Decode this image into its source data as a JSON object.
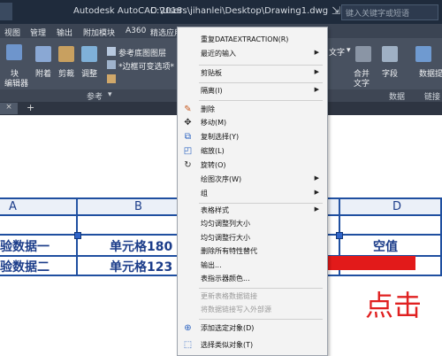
{
  "titlebar": {
    "app_name": "Autodesk AutoCAD 2018",
    "file_path": "C:\\Users\\jihanlei\\Desktop\\Drawing1.dwg",
    "search_placeholder": "键入关键字或短语"
  },
  "menubar": {
    "items": [
      "视图",
      "管理",
      "输出",
      "附加模块",
      "A360",
      "精选应用"
    ]
  },
  "ribbon": {
    "left_buttons": [
      "块",
      "编辑器",
      "附着",
      "剪裁",
      "调整"
    ],
    "reference_items": [
      "参考底图图层",
      "*边框可变选项*"
    ],
    "panel_reference": "参考",
    "right_buttons": [
      "文字",
      "合并",
      "文字",
      "字段"
    ],
    "panel_data": "数据",
    "data_extract": "数据提",
    "link_panel": "链接"
  },
  "table": {
    "col_headers": [
      "A",
      "B",
      "D"
    ],
    "rows": [
      {
        "c1": "验数据一",
        "c2": "单元格180",
        "c4": "空值"
      },
      {
        "c1": "验数据二",
        "c2": "单元格123",
        "c4": ""
      }
    ]
  },
  "context_menu": {
    "items": [
      {
        "label": "重复DATAEXTRACTION(R)",
        "submenu": false,
        "disabled": false
      },
      {
        "label": "最近的输入",
        "submenu": true,
        "disabled": false
      },
      {
        "label": "剪贴板",
        "submenu": true,
        "disabled": false
      },
      {
        "label": "隔离(I)",
        "submenu": true,
        "disabled": false
      },
      {
        "label": "删除",
        "submenu": false,
        "disabled": false,
        "icon": "eraser-icon"
      },
      {
        "label": "移动(M)",
        "submenu": false,
        "disabled": false,
        "icon": "move-icon"
      },
      {
        "label": "复制选择(Y)",
        "submenu": false,
        "disabled": false,
        "icon": "copy-icon"
      },
      {
        "label": "缩放(L)",
        "submenu": false,
        "disabled": false,
        "icon": "scale-icon"
      },
      {
        "label": "旋转(O)",
        "submenu": false,
        "disabled": false,
        "icon": "rotate-icon"
      },
      {
        "label": "绘图次序(W)",
        "submenu": true,
        "disabled": false
      },
      {
        "label": "组",
        "submenu": true,
        "disabled": false
      },
      {
        "label": "表格样式",
        "submenu": true,
        "disabled": false
      },
      {
        "label": "均匀调整列大小",
        "submenu": false,
        "disabled": false
      },
      {
        "label": "均匀调整行大小",
        "submenu": false,
        "disabled": false
      },
      {
        "label": "删除所有特性替代",
        "submenu": false,
        "disabled": false
      },
      {
        "label": "输出...",
        "submenu": false,
        "disabled": false
      },
      {
        "label": "表指示器颜色...",
        "submenu": false,
        "disabled": false
      },
      {
        "label": "更新表格数据链接",
        "submenu": false,
        "disabled": true
      },
      {
        "label": "将数据链接写入外部源",
        "submenu": false,
        "disabled": true
      },
      {
        "label": "添加选定对象(D)",
        "submenu": false,
        "disabled": false,
        "icon": "add-object-icon"
      },
      {
        "label": "选择类似对象(T)",
        "submenu": false,
        "disabled": false,
        "icon": "select-similar-icon"
      }
    ]
  },
  "annotation": {
    "click_text": "点击",
    "arrow_color": "#e21a1a"
  }
}
